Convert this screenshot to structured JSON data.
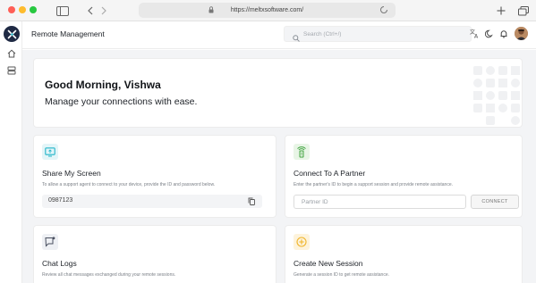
{
  "browser": {
    "url": "https://meltxsoftware.com/"
  },
  "header": {
    "title": "Remote Management",
    "search_placeholder": "Search (Ctrl+/)"
  },
  "hero": {
    "greeting": "Good Morning, Vishwa",
    "tagline": "Manage your connections with ease."
  },
  "cards": {
    "share": {
      "title": "Share My Screen",
      "description": "To allow a support agent to connect to your device, provide the ID and password below.",
      "device_id": "0987123"
    },
    "connect": {
      "title": "Connect To A Partner",
      "description": "Enter the partner's ID to begin a support session and provide remote assistance.",
      "input_placeholder": "Partner ID",
      "button_label": "CONNECT"
    },
    "chat": {
      "title": "Chat Logs",
      "description": "Review all chat messages exchanged during your remote sessions."
    },
    "session": {
      "title": "Create New Session",
      "description": "Generate a session ID to get remote assistance."
    }
  },
  "colors": {
    "accent_teal": "#23b5c9",
    "accent_green": "#3fa33f",
    "accent_amber": "#f0b429",
    "logo_bg": "#1f2a44",
    "page_bg": "#f3f4f6"
  },
  "icons": {
    "sidebar": [
      "logo-icon",
      "home-icon",
      "server-icon"
    ],
    "header": [
      "translate-icon",
      "moon-icon",
      "bell-icon"
    ],
    "cards": [
      "screen-share-icon",
      "signal-tower-icon",
      "chat-icon",
      "add-circle-icon"
    ]
  }
}
